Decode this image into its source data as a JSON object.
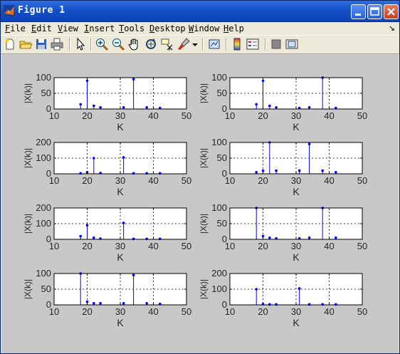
{
  "window": {
    "title": "Figure 1"
  },
  "menus": [
    "File",
    "Edit",
    "View",
    "Insert",
    "Tools",
    "Desktop",
    "Window",
    "Help"
  ],
  "dock_symbol": "↘",
  "toolbar": [
    "new-figure",
    "open-file",
    "save",
    "print",
    "edit-plot",
    "zoom-in",
    "zoom-out",
    "pan",
    "rotate-3d",
    "data-cursor",
    "brush",
    "insert-colorbar",
    "insert-legend",
    "hide-plot-tools",
    "show-plot-tools"
  ],
  "axis_text": {
    "xlabel": "K",
    "ylabel": "|X(k)|"
  },
  "chart_data": [
    {
      "type": "stem",
      "xlim": [
        10,
        50
      ],
      "ylim": [
        0,
        100
      ],
      "xticks": [
        10,
        20,
        30,
        40,
        50
      ],
      "yticks": [
        0,
        50,
        100
      ],
      "xlabel": "K",
      "ylabel": "|X(k)|",
      "grid": true,
      "x": [
        18,
        20,
        22,
        24,
        31,
        34,
        38,
        42
      ],
      "y": [
        15,
        90,
        10,
        5,
        5,
        95,
        5,
        3
      ]
    },
    {
      "type": "stem",
      "xlim": [
        10,
        50
      ],
      "ylim": [
        0,
        100
      ],
      "xticks": [
        10,
        20,
        30,
        40,
        50
      ],
      "yticks": [
        0,
        50,
        100
      ],
      "xlabel": "K",
      "ylabel": "|X(k)|",
      "grid": true,
      "x": [
        18,
        20,
        22,
        24,
        31,
        34,
        38,
        42
      ],
      "y": [
        15,
        90,
        10,
        5,
        3,
        5,
        100,
        3
      ]
    },
    {
      "type": "stem",
      "xlim": [
        10,
        50
      ],
      "ylim": [
        0,
        200
      ],
      "xticks": [
        10,
        20,
        30,
        40,
        50
      ],
      "yticks": [
        0,
        100,
        200
      ],
      "xlabel": "K",
      "ylabel": "|X(k)|",
      "grid": true,
      "x": [
        18,
        20,
        22,
        24,
        31,
        34,
        38,
        42
      ],
      "y": [
        3,
        10,
        100,
        5,
        105,
        3,
        3,
        3
      ]
    },
    {
      "type": "stem",
      "xlim": [
        10,
        50
      ],
      "ylim": [
        0,
        100
      ],
      "xticks": [
        10,
        20,
        30,
        40,
        50
      ],
      "yticks": [
        0,
        50,
        100
      ],
      "xlabel": "K",
      "ylabel": "|X(k)|",
      "grid": true,
      "x": [
        18,
        20,
        22,
        24,
        31,
        34,
        38,
        42
      ],
      "y": [
        5,
        10,
        100,
        10,
        10,
        95,
        10,
        5
      ]
    },
    {
      "type": "stem",
      "xlim": [
        10,
        50
      ],
      "ylim": [
        0,
        200
      ],
      "xticks": [
        10,
        20,
        30,
        40,
        50
      ],
      "yticks": [
        0,
        100,
        200
      ],
      "xlabel": "K",
      "ylabel": "|X(k)|",
      "grid": true,
      "x": [
        18,
        20,
        22,
        24,
        31,
        34,
        38,
        42
      ],
      "y": [
        20,
        90,
        10,
        5,
        105,
        3,
        3,
        3
      ]
    },
    {
      "type": "stem",
      "xlim": [
        10,
        50
      ],
      "ylim": [
        0,
        100
      ],
      "xticks": [
        10,
        20,
        30,
        40,
        50
      ],
      "yticks": [
        0,
        50,
        100
      ],
      "xlabel": "K",
      "ylabel": "|X(k)|",
      "grid": true,
      "x": [
        18,
        20,
        22,
        24,
        31,
        34,
        38,
        42
      ],
      "y": [
        100,
        10,
        5,
        3,
        3,
        5,
        100,
        5
      ]
    },
    {
      "type": "stem",
      "xlim": [
        10,
        50
      ],
      "ylim": [
        0,
        100
      ],
      "xticks": [
        10,
        20,
        30,
        40,
        50
      ],
      "yticks": [
        0,
        50,
        100
      ],
      "xlabel": "K",
      "ylabel": "|X(k)|",
      "grid": true,
      "x": [
        18,
        20,
        22,
        24,
        31,
        34,
        38,
        42
      ],
      "y": [
        100,
        10,
        5,
        5,
        5,
        95,
        5,
        3
      ]
    },
    {
      "type": "stem",
      "xlim": [
        10,
        50
      ],
      "ylim": [
        0,
        200
      ],
      "xticks": [
        10,
        20,
        30,
        40,
        50
      ],
      "yticks": [
        0,
        100,
        200
      ],
      "xlabel": "K",
      "ylabel": "|X(k)|",
      "grid": true,
      "x": [
        18,
        20,
        22,
        24,
        31,
        34,
        38,
        42
      ],
      "y": [
        100,
        5,
        3,
        3,
        105,
        3,
        3,
        3
      ]
    }
  ],
  "colors": {
    "stem": "#0000ff",
    "figure_bg": "#c8c8c8",
    "axes_bg": "#ffffff",
    "axes": "#000000",
    "label": "#262626"
  }
}
